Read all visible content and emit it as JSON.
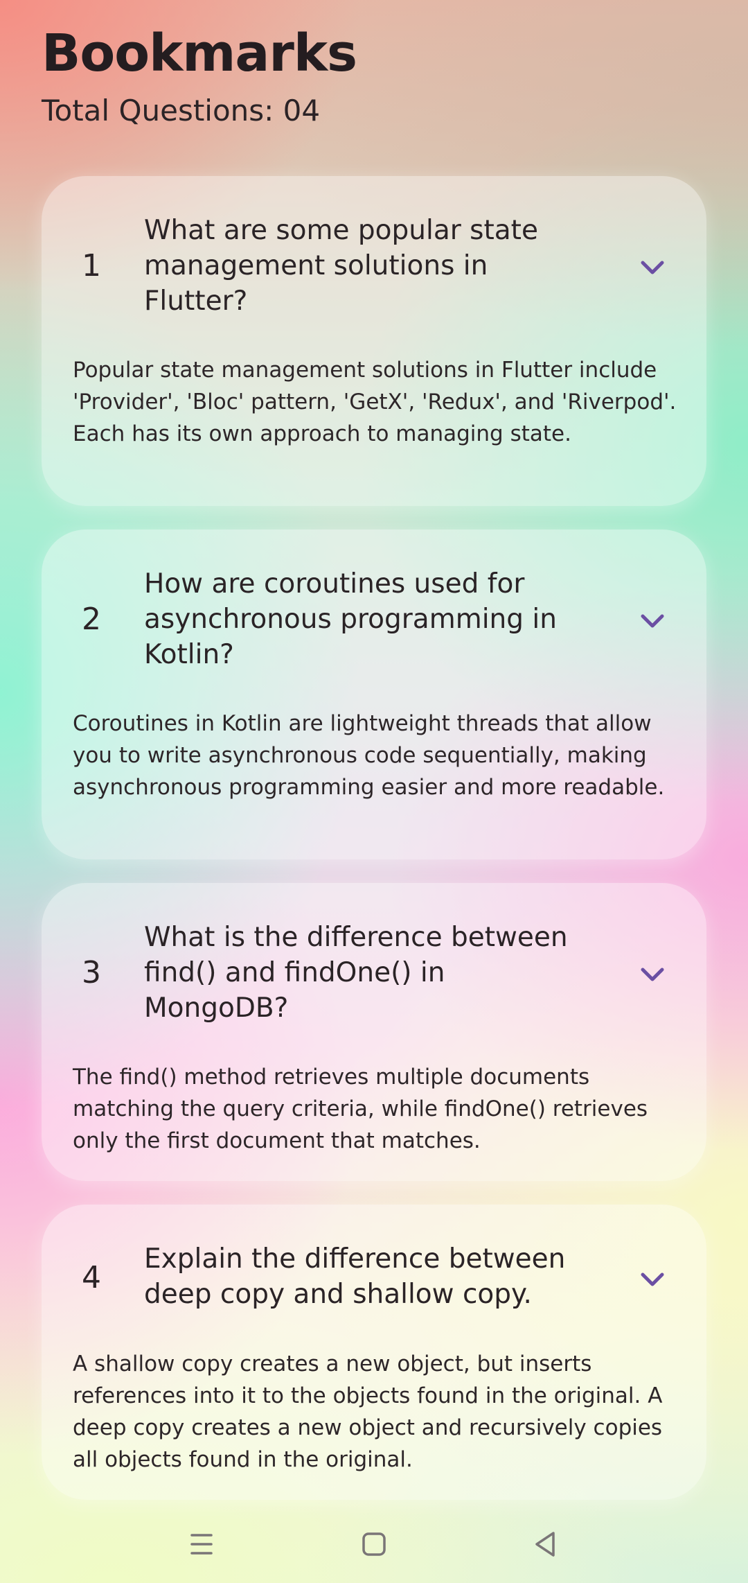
{
  "header": {
    "title": "Bookmarks",
    "total_questions": "Total Questions: 04"
  },
  "cards": [
    {
      "number": "1",
      "question": "What are some popular state management solutions in Flutter?",
      "answer": "Popular state management solutions in Flutter include 'Provider', 'Bloc' pattern, 'GetX', 'Redux', and 'Riverpod'. Each has its own approach to managing state."
    },
    {
      "number": "2",
      "question": "How are coroutines used for asynchronous programming in Kotlin?",
      "answer": "Coroutines in Kotlin are lightweight threads that allow you to write asynchronous code sequentially, making asynchronous programming easier and more readable."
    },
    {
      "number": "3",
      "question": "What is the difference between find() and findOne() in MongoDB?",
      "answer": "The find() method retrieves multiple documents matching the query criteria, while findOne() retrieves only the first document that matches."
    },
    {
      "number": "4",
      "question": "Explain the difference between deep copy and shallow copy.",
      "answer": "A shallow copy creates a new object, but inserts references into it to the objects found in the original. A deep copy creates a new object and recursively copies all objects found in the original."
    }
  ],
  "icons": {
    "expand": "chevron-down-icon",
    "nav_menu": "menu-icon",
    "nav_home": "home-icon",
    "nav_back": "back-icon"
  },
  "colors": {
    "chevron": "#6b4fa3",
    "nav_icon": "#7a7577"
  }
}
